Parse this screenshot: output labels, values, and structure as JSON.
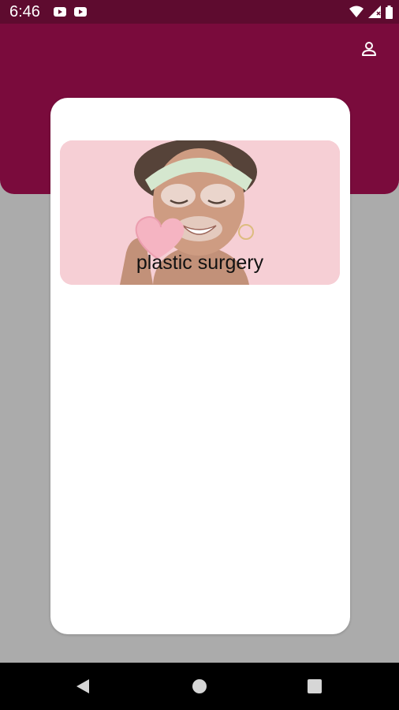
{
  "status_bar": {
    "time": "6:46",
    "left_icons": [
      "youtube-icon",
      "youtube-icon"
    ],
    "right_icons": [
      "wifi-icon",
      "cell-signal-icon",
      "battery-icon"
    ]
  },
  "header": {
    "profile_icon": "person-icon"
  },
  "categories": [
    {
      "label": "plastic surgery",
      "image": "woman-with-face-mask-heart-sponge"
    }
  ],
  "nav_bar": {
    "icons": [
      "back-icon",
      "home-icon",
      "recents-icon"
    ]
  },
  "colors": {
    "status_bar": "#5e0b2f",
    "header": "#7a0b3c",
    "background": "#ababab",
    "card": "#ffffff",
    "category_bg": "#f5c7cf"
  }
}
